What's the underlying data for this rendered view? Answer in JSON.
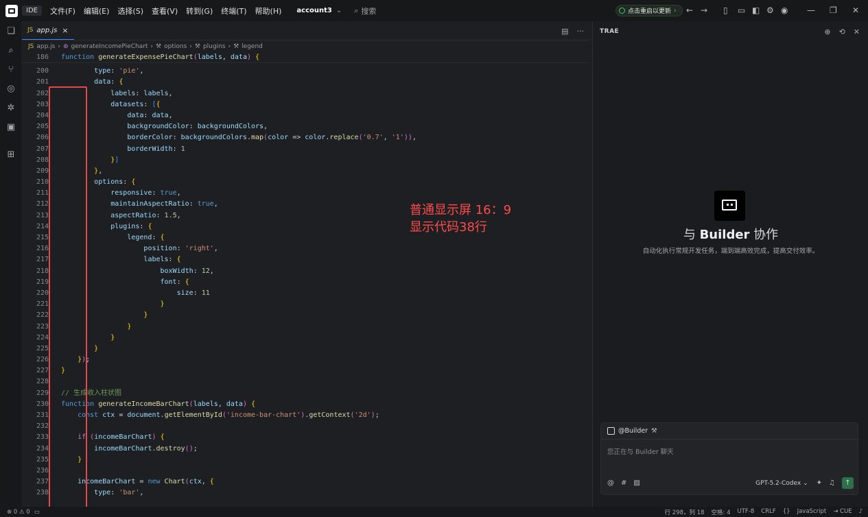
{
  "titlebar": {
    "ide_tag": "IDE",
    "menu": [
      "文件(F)",
      "编辑(E)",
      "选择(S)",
      "查看(V)",
      "转到(G)",
      "终端(T)",
      "帮助(H)"
    ],
    "account": "account3",
    "search_placeholder": "搜索",
    "update_label": "点击重启以更新"
  },
  "editor": {
    "tab_label": "app.js",
    "tab_lang": "JS",
    "breadcrumb": [
      "app.js",
      "generateIncomePieChart",
      "options",
      "plugins",
      "legend"
    ],
    "sticky_line": {
      "number": "186",
      "code": "function generateExpensePieChart(labels, data) {"
    },
    "lines": [
      {
        "n": "200",
        "c": "        type: 'pie',"
      },
      {
        "n": "201",
        "c": "        data: {"
      },
      {
        "n": "202",
        "c": "            labels: labels,"
      },
      {
        "n": "203",
        "c": "            datasets: [{"
      },
      {
        "n": "204",
        "c": "                data: data,"
      },
      {
        "n": "205",
        "c": "                backgroundColor: backgroundColors,"
      },
      {
        "n": "206",
        "c": "                borderColor: backgroundColors.map(color => color.replace('0.7', '1')),"
      },
      {
        "n": "207",
        "c": "                borderWidth: 1"
      },
      {
        "n": "208",
        "c": "            }]"
      },
      {
        "n": "209",
        "c": "        },"
      },
      {
        "n": "210",
        "c": "        options: {"
      },
      {
        "n": "211",
        "c": "            responsive: true,"
      },
      {
        "n": "212",
        "c": "            maintainAspectRatio: true,"
      },
      {
        "n": "213",
        "c": "            aspectRatio: 1.5,"
      },
      {
        "n": "214",
        "c": "            plugins: {"
      },
      {
        "n": "215",
        "c": "                legend: {"
      },
      {
        "n": "216",
        "c": "                    position: 'right',"
      },
      {
        "n": "217",
        "c": "                    labels: {"
      },
      {
        "n": "218",
        "c": "                        boxWidth: 12,"
      },
      {
        "n": "219",
        "c": "                        font: {"
      },
      {
        "n": "220",
        "c": "                            size: 11"
      },
      {
        "n": "221",
        "c": "                        }"
      },
      {
        "n": "222",
        "c": "                    }"
      },
      {
        "n": "223",
        "c": "                }"
      },
      {
        "n": "224",
        "c": "            }"
      },
      {
        "n": "225",
        "c": "        }"
      },
      {
        "n": "226",
        "c": "    });"
      },
      {
        "n": "227",
        "c": "}"
      },
      {
        "n": "228",
        "c": ""
      },
      {
        "n": "229",
        "c": "// 生成收入柱状图"
      },
      {
        "n": "230",
        "c": "function generateIncomeBarChart(labels, data) {"
      },
      {
        "n": "231",
        "c": "    const ctx = document.getElementById('income-bar-chart').getContext('2d');"
      },
      {
        "n": "232",
        "c": ""
      },
      {
        "n": "233",
        "c": "    if (incomeBarChart) {"
      },
      {
        "n": "234",
        "c": "        incomeBarChart.destroy();"
      },
      {
        "n": "235",
        "c": "    }"
      },
      {
        "n": "236",
        "c": ""
      },
      {
        "n": "237",
        "c": "    incomeBarChart = new Chart(ctx, {"
      },
      {
        "n": "238",
        "c": "        type: 'bar',"
      }
    ],
    "annotation": [
      "普通显示屏 16：9",
      "显示代码38行"
    ]
  },
  "panel": {
    "title": "TRAE",
    "heading_prefix": "与",
    "heading_name": "Builder",
    "heading_suffix": "协作",
    "subtitle": "自动化执行常规开发任务，端到端高效完成，提高交付效率。",
    "chat_agent": "@Builder",
    "chat_placeholder": "您正在与 Builder 聊天",
    "model": "GPT-5.2-Codex"
  },
  "statusbar": {
    "errors": "0",
    "warnings": "0",
    "position": "行 298，列 18",
    "spaces": "空格: 4",
    "encoding": "UTF-8",
    "eol": "CRLF",
    "braces": "{}",
    "language": "JavaScript",
    "cue": "CUE"
  }
}
